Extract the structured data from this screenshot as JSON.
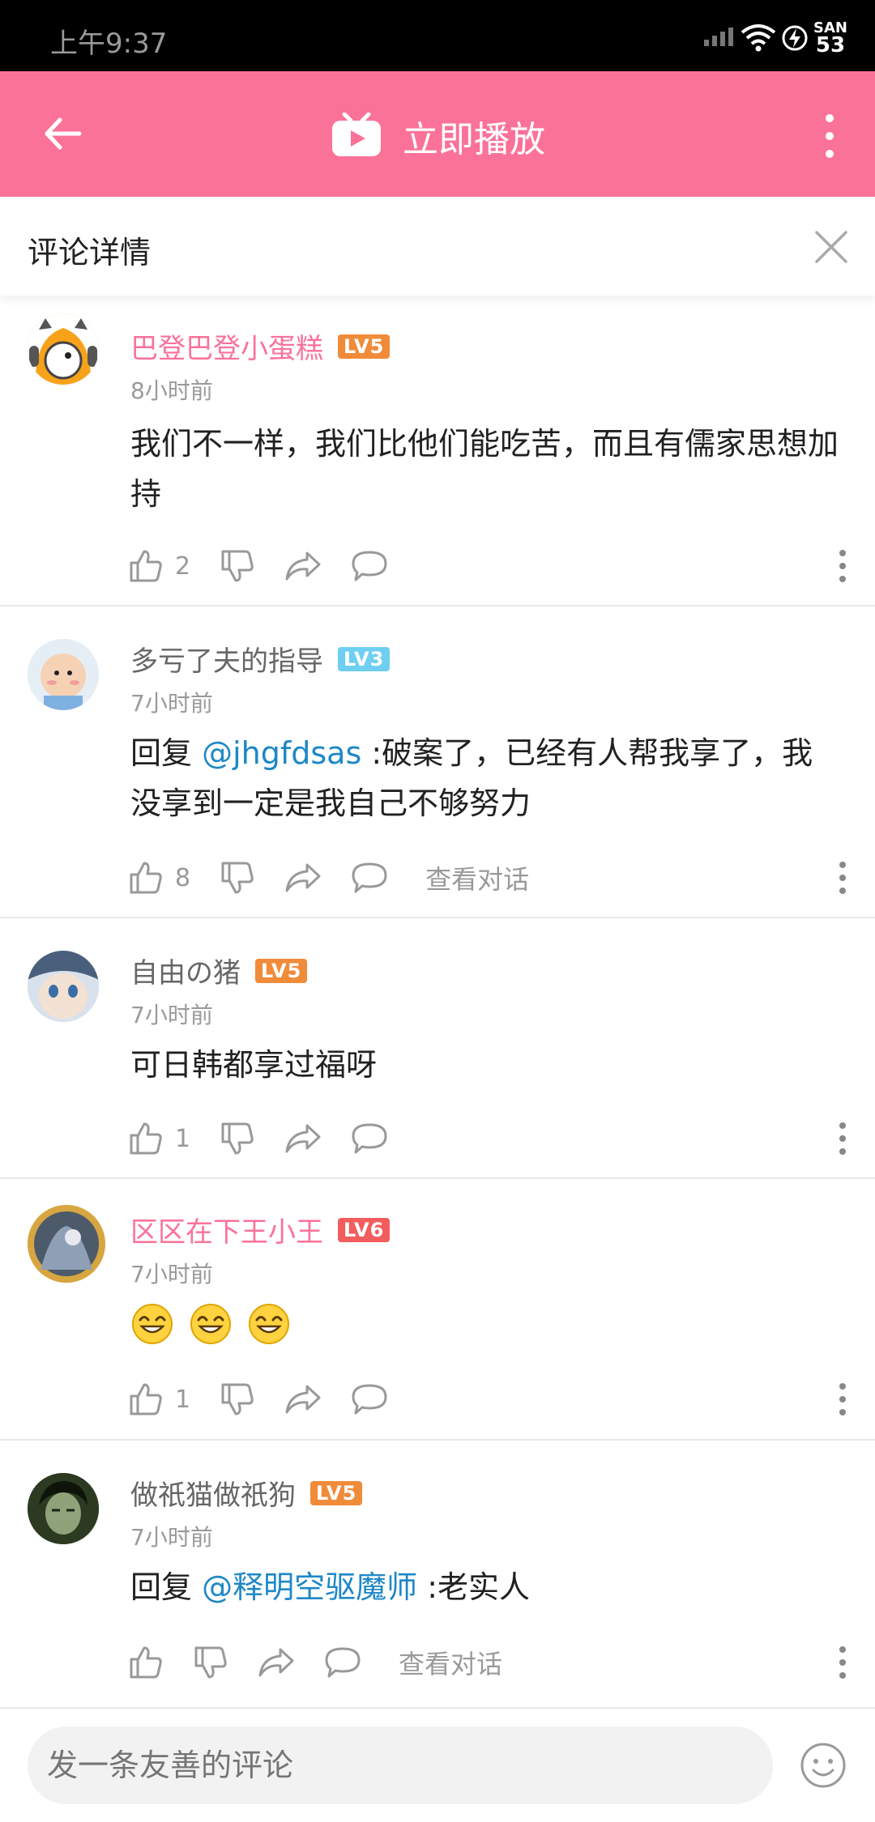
{
  "status_bar": {
    "time": "上午9:37",
    "battery_top": "SAN",
    "battery_level": "53"
  },
  "app_bar": {
    "title": "立即播放",
    "accent": "#fb7299"
  },
  "sub_header": {
    "title": "评论详情"
  },
  "comments": [
    {
      "name": "巴登巴登小蛋糕",
      "name_vip": true,
      "level": "LV5",
      "level_color": "#f08b3a",
      "time": "8小时前",
      "text": "我们不一样，我们比他们能吃苦，而且有儒家思想加持",
      "likes": "2",
      "show_talk": false
    },
    {
      "name": "多亏了夫的指导",
      "name_vip": false,
      "level": "LV3",
      "level_color": "#6ecff0",
      "time": "7小时前",
      "reply_prefix": "回复 ",
      "mention": "@jhgfdsas",
      "text": " :破案了，已经有人帮我享了，我没享到一定是我自己不够努力",
      "likes": "8",
      "talk_label": "查看对话",
      "show_talk": true
    },
    {
      "name": "自由の猪",
      "name_vip": false,
      "level": "LV5",
      "level_color": "#f08b3a",
      "time": "7小时前",
      "text": "可日韩都享过福呀",
      "likes": "1",
      "show_talk": false
    },
    {
      "name": "区区在下王小王",
      "name_vip": true,
      "level": "LV6",
      "level_color": "#f25d5d",
      "time": "7小时前",
      "emojis": [
        "smile-emoji",
        "smile-emoji",
        "smile-emoji"
      ],
      "likes": "1",
      "show_talk": false
    },
    {
      "name": "做祇猫做祇狗",
      "name_vip": false,
      "level": "LV5",
      "level_color": "#f08b3a",
      "time": "7小时前",
      "reply_prefix": "回复 ",
      "mention": "@释明空驱魔师",
      "text": " :老实人",
      "likes": "",
      "talk_label": "查看对话",
      "show_talk": true
    }
  ],
  "bottom_bar": {
    "placeholder": "发一条友善的评论"
  }
}
